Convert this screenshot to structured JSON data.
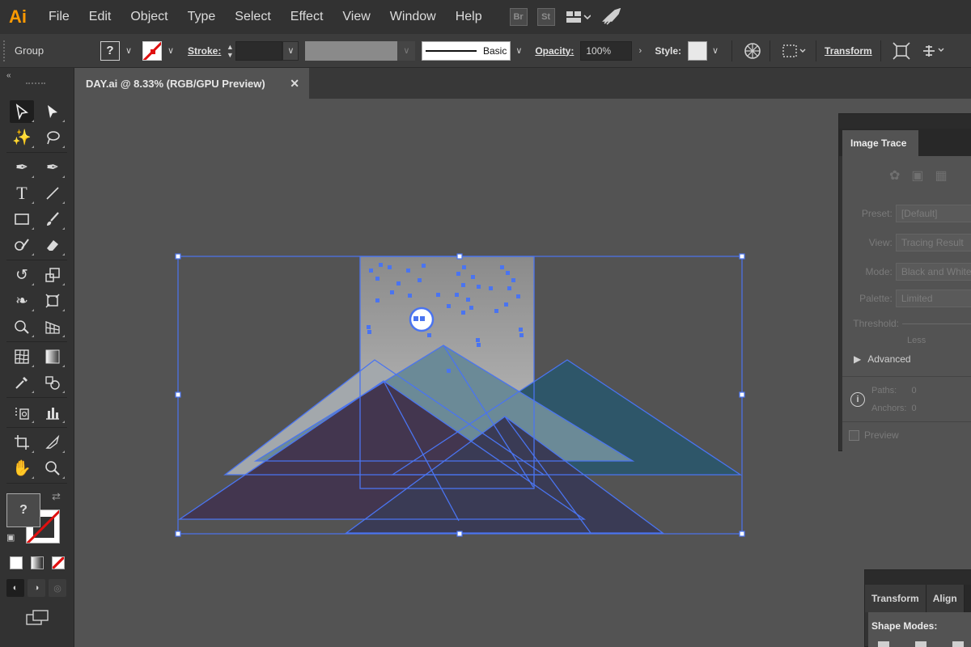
{
  "app": {
    "logo": "Ai"
  },
  "menu": {
    "items": [
      "File",
      "Edit",
      "Object",
      "Type",
      "Select",
      "Effect",
      "View",
      "Window",
      "Help"
    ],
    "bridge": "Br",
    "stock": "St"
  },
  "control_bar": {
    "selection_type": "Group",
    "fill_label": "?",
    "stroke_label": "Stroke:",
    "brush_label": "Basic",
    "opacity_label": "Opacity:",
    "opacity_value": "100%",
    "style_label": "Style:",
    "transform_label": "Transform"
  },
  "document": {
    "tab_title": "DAY.ai @ 8.33% (RGB/GPU Preview)",
    "close": "✕"
  },
  "tools": {
    "fill_label": "?"
  },
  "image_trace": {
    "title": "Image Trace",
    "preset_label": "Preset:",
    "preset_value": "[Default]",
    "view_label": "View:",
    "view_value": "Tracing Result",
    "mode_label": "Mode:",
    "mode_value": "Black and White",
    "palette_label": "Palette:",
    "palette_value": "Limited",
    "threshold_label": "Threshold:",
    "less_label": "Less",
    "advanced_label": "Advanced",
    "paths_label": "Paths:",
    "paths_value": "0",
    "anchors_label": "Anchors:",
    "anchors_value": "0",
    "preview_label": "Preview"
  },
  "transform_panel": {
    "tabs": [
      "Transform",
      "Align"
    ],
    "shape_modes_label": "Shape Modes:"
  },
  "colors": {
    "accent_logo": "#ff9a00",
    "selection": "#4a74f0",
    "mountain_dark": "#43364f",
    "mountain_teal": "#2e5669",
    "mountain_mid": "#6b8a97",
    "sky_top": "#8a8a8a",
    "sky_bottom": "#c6c6c6"
  }
}
